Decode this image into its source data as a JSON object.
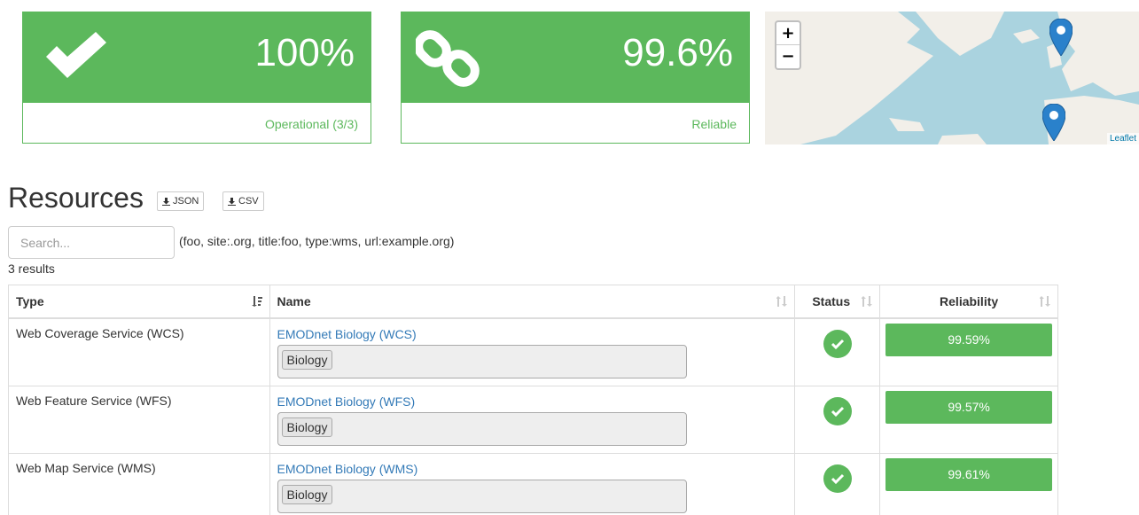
{
  "panels": [
    {
      "icon": "checkmark-icon",
      "value": "100%",
      "footer": "Operational (3/3)"
    },
    {
      "icon": "link-icon",
      "value": "99.6%",
      "footer": "Reliable"
    }
  ],
  "map": {
    "zoom_in": "+",
    "zoom_out": "−",
    "attribution": "Leaflet"
  },
  "resources": {
    "title": "Resources",
    "json_label": "JSON",
    "csv_label": "CSV",
    "search_placeholder": "Search...",
    "search_hint": "(foo, site:.org, title:foo, type:wms, url:example.org)",
    "results_count": "3 results"
  },
  "table": {
    "headers": {
      "type": "Type",
      "name": "Name",
      "status": "Status",
      "reliability": "Reliability"
    },
    "rows": [
      {
        "type": "Web Coverage Service (WCS)",
        "name": "EMODnet Biology (WCS)",
        "tag": "Biology",
        "status": "ok",
        "reliability": "99.59%"
      },
      {
        "type": "Web Feature Service (WFS)",
        "name": "EMODnet Biology (WFS)",
        "tag": "Biology",
        "status": "ok",
        "reliability": "99.57%"
      },
      {
        "type": "Web Map Service (WMS)",
        "name": "EMODnet Biology (WMS)",
        "tag": "Biology",
        "status": "ok",
        "reliability": "99.61%"
      }
    ]
  },
  "colors": {
    "success": "#5cb85c",
    "link": "#337ab7",
    "map_water": "#aad3df",
    "map_land": "#f2efe9"
  }
}
